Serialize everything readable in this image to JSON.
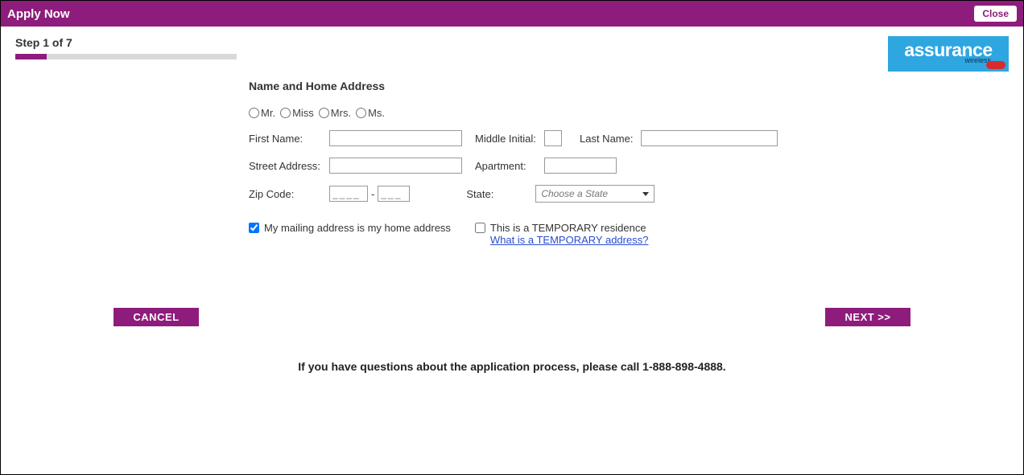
{
  "titlebar": {
    "title": "Apply Now",
    "close": "Close"
  },
  "step": {
    "label": "Step 1 of 7",
    "percent": 14
  },
  "logo": {
    "main": "assurance",
    "sub": "wireless"
  },
  "form": {
    "section_title": "Name and Home Address",
    "salutations": {
      "mr": "Mr.",
      "miss": "Miss",
      "mrs": "Mrs.",
      "ms": "Ms."
    },
    "labels": {
      "first_name": "First Name:",
      "middle_initial": "Middle Initial:",
      "last_name": "Last Name:",
      "street": "Street Address:",
      "apartment": "Apartment:",
      "zip": "Zip Code:",
      "state": "State:"
    },
    "state_placeholder": "Choose a State",
    "zip_mask1": "____",
    "zip_mask2": "___",
    "checkboxes": {
      "mailing_same": "My mailing address is my home address",
      "temporary": "This is a TEMPORARY residence",
      "temp_link": "What is a TEMPORARY address?"
    }
  },
  "buttons": {
    "cancel": "CANCEL",
    "next": "NEXT >>"
  },
  "help": "If you have questions about the application process, please call 1-888-898-4888."
}
